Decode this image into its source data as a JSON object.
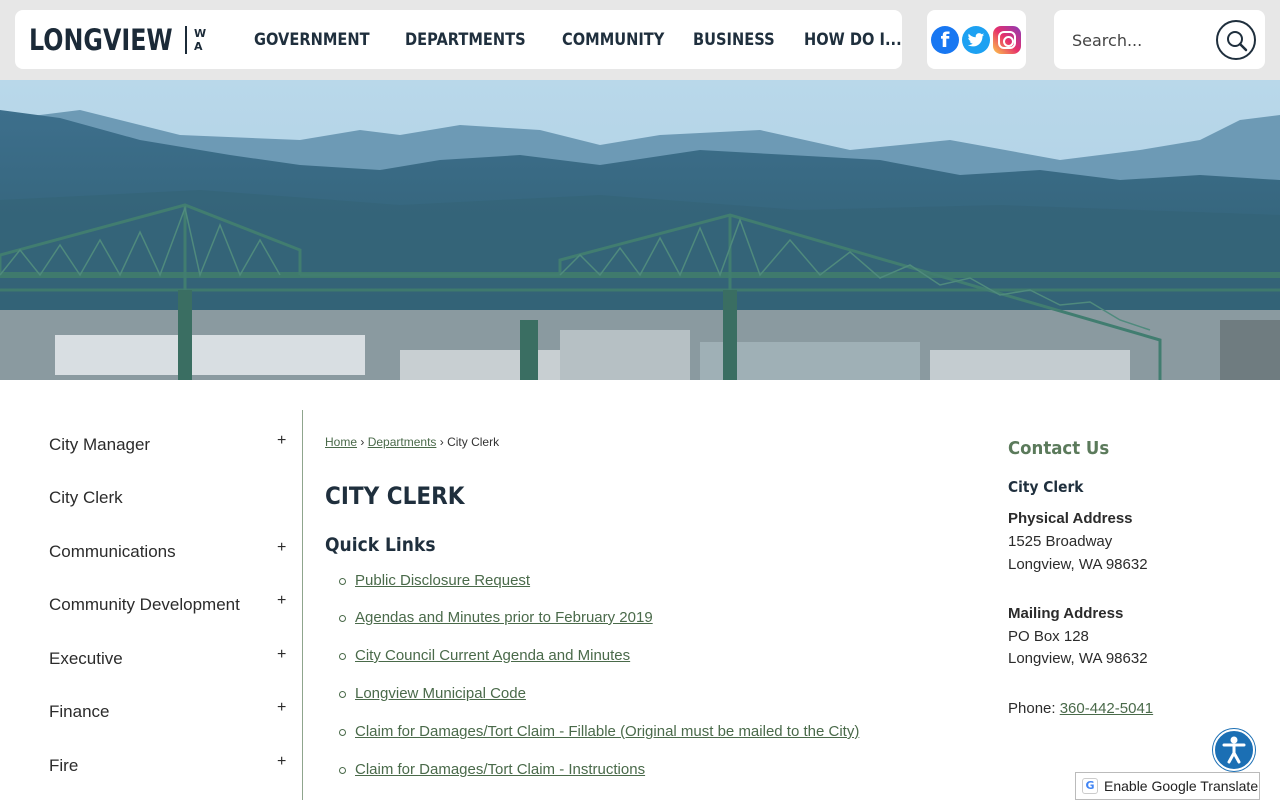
{
  "header": {
    "logo_main": "LONGVIEW",
    "logo_state_top": "W",
    "logo_state_bottom": "A",
    "nav": [
      "GOVERNMENT",
      "DEPARTMENTS",
      "COMMUNITY",
      "BUSINESS",
      "HOW DO I..."
    ],
    "social": {
      "facebook_icon": "facebook-icon",
      "twitter_icon": "twitter-icon",
      "instagram_icon": "instagram-icon"
    },
    "search_placeholder": "Search..."
  },
  "sidebar": {
    "items": [
      {
        "label": "City Manager",
        "expand": "+"
      },
      {
        "label": "City Clerk",
        "expand": ""
      },
      {
        "label": "Communications",
        "expand": "+"
      },
      {
        "label": "Community Development",
        "expand": "+"
      },
      {
        "label": "Executive",
        "expand": "+"
      },
      {
        "label": "Finance",
        "expand": "+"
      },
      {
        "label": "Fire",
        "expand": "+"
      }
    ]
  },
  "breadcrumb": {
    "home": "Home",
    "sep1": "›",
    "departments": "Departments",
    "sep2": "›",
    "current": "City Clerk"
  },
  "main": {
    "title": "CITY CLERK",
    "quick_links_title": "Quick Links",
    "quick_links": [
      "Public Disclosure Request",
      "Agendas and Minutes prior to February 2019",
      "City Council Current Agenda and Minutes",
      "Longview Municipal Code",
      "Claim for Damages/Tort Claim - Fillable (Original must be mailed to the City)",
      "Claim for Damages/Tort Claim - Instructions"
    ]
  },
  "contact": {
    "title": "Contact Us",
    "department": "City Clerk",
    "physical_label": "Physical Address",
    "physical_line1": "1525 Broadway",
    "physical_line2": "Longview, WA 98632",
    "mailing_label": "Mailing Address",
    "mailing_line1": "PO Box 128",
    "mailing_line2": "Longview, WA 98632",
    "phone_label": "Phone:",
    "phone": "360-442-5041"
  },
  "translate_label": "Enable Google Translate",
  "colors": {
    "accent_green": "#4a6a4a",
    "header_bg": "#e7e7e7",
    "nav_text": "#1f2f3d",
    "accessibility_blue": "#1b6fb4"
  }
}
